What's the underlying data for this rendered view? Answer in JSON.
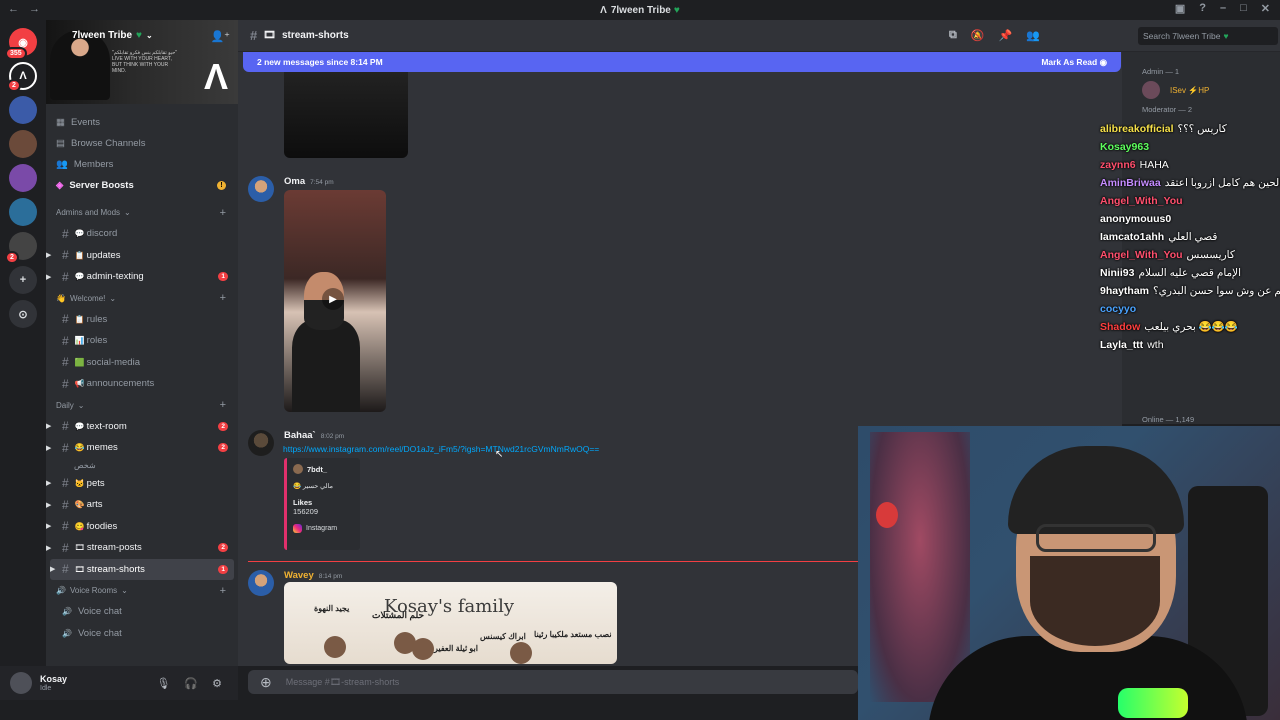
{
  "window": {
    "title": "7lween Tribe"
  },
  "rail": {
    "servers": [
      {
        "name": "discord-home",
        "badge": "355"
      },
      {
        "name": "7lween",
        "badge": "2"
      },
      {
        "name": "server-3",
        "badge": ""
      },
      {
        "name": "server-4",
        "badge": ""
      },
      {
        "name": "server-5",
        "badge": ""
      },
      {
        "name": "server-6",
        "badge": ""
      },
      {
        "name": "server-7",
        "badge": "2"
      }
    ]
  },
  "server": {
    "name": "7lween Tribe",
    "quote": "\"حيو تقابلكم بنس فكرو تقابلكم\" LIVE WITH YOUR HEART, BUT THINK WITH YOUR MIND."
  },
  "nav": {
    "events": "Events",
    "browse": "Browse Channels",
    "members": "Members",
    "boosts": "Server Boosts"
  },
  "categories": {
    "admins": "Admins and Mods",
    "welcome": "Welcome!",
    "daily": "Daily",
    "voice": "Voice Rooms"
  },
  "channels": {
    "admins": [
      {
        "name": "discord",
        "emoji": "💬",
        "count": "",
        "unread": false,
        "arrow": false
      },
      {
        "name": "updates",
        "emoji": "📋",
        "count": "",
        "unread": true,
        "arrow": true
      },
      {
        "name": "admin-texting",
        "emoji": "💬",
        "count": "1",
        "unread": true,
        "arrow": true
      }
    ],
    "welcome": [
      {
        "name": "rules",
        "emoji": "📋",
        "count": "",
        "unread": false,
        "arrow": false
      },
      {
        "name": "roles",
        "emoji": "📊",
        "count": "",
        "unread": false,
        "arrow": false
      },
      {
        "name": "social-media",
        "emoji": "🟩",
        "count": "",
        "unread": false,
        "arrow": false
      },
      {
        "name": "announcements",
        "emoji": "📢",
        "count": "",
        "unread": false,
        "arrow": false
      }
    ],
    "daily": [
      {
        "name": "text-room",
        "emoji": "💬",
        "count": "2",
        "unread": true,
        "arrow": true
      },
      {
        "name": "memes",
        "emoji": "😂",
        "count": "2",
        "unread": true,
        "arrow": true
      },
      {
        "name": "pets",
        "emoji": "🐱",
        "count": "",
        "unread": true,
        "arrow": true
      },
      {
        "name": "arts",
        "emoji": "🎨",
        "count": "",
        "unread": true,
        "arrow": true
      },
      {
        "name": "foodies",
        "emoji": "😋",
        "count": "",
        "unread": true,
        "arrow": true
      },
      {
        "name": "stream-posts",
        "emoji": "🎞",
        "count": "2",
        "unread": true,
        "arrow": true
      },
      {
        "name": "stream-shorts",
        "emoji": "🎞",
        "count": "1",
        "unread": true,
        "arrow": true,
        "active": true
      }
    ],
    "daily_sub": "شخص",
    "voice": [
      {
        "name": "Voice chat"
      },
      {
        "name": "Voice chat"
      }
    ]
  },
  "user": {
    "name": "Kosay",
    "status": "Idle"
  },
  "header": {
    "channel": "stream-shorts",
    "search": "Search 7lween Tribe"
  },
  "newbar": {
    "text": "2 new messages since 8:14 PM",
    "mark": "Mark As Read"
  },
  "messages": [
    {
      "author": "Oma",
      "time": "7:54 pm",
      "color": "#f2f3f5"
    },
    {
      "author": "Bahaa`",
      "time": "8:02 pm",
      "color": "#f2f3f5",
      "link": "https://www.instagram.com/reel/DO1aJz_iFm5/?igsh=MTNwd21rcGVmNmRwOQ==",
      "embed": {
        "author": "7bdt_",
        "desc": "مالي حسير",
        "likes_label": "Likes",
        "likes": "156209",
        "source": "Instagram"
      }
    },
    {
      "author": "Wavey",
      "time": "8:14 pm",
      "color": "#f2f3f5"
    }
  ],
  "family_image": {
    "title": "Kosay's family",
    "labels": [
      "يجيد النهوة",
      "حلم المشتلات",
      "نصب مستعد ملكيبا رئينا",
      "ابراك كيسنس",
      "ابو ثيلة العفير"
    ]
  },
  "composer": {
    "placeholder": "Message #🎞-stream-shorts"
  },
  "member_list": {
    "admin": "Admin — 1",
    "admin_member": "ISev ⚡HP",
    "moderator": "Moderator — 2",
    "online": "Online — 1,149"
  },
  "chat_overlay": [
    {
      "user": "alibreakofficial",
      "text": "كاريس ؟؟؟",
      "color": "#f5e04a"
    },
    {
      "user": "Kosay963",
      "text": "",
      "color": "#5dff5d"
    },
    {
      "user": "zaynn6",
      "text": "HAHA",
      "color": "#ff4f6d"
    },
    {
      "user": "AminBriwaa",
      "text": "روم الحين هم كامل ازروبا اعتقد",
      "color": "#c58cff"
    },
    {
      "user": "Angel_With_You",
      "text": "",
      "color": "#ff4f6d"
    },
    {
      "user": "anonymouus0",
      "text": "",
      "color": "#ffffff"
    },
    {
      "user": "Iamcato1ahh",
      "text": "قصي العلي",
      "color": "#ffffff"
    },
    {
      "user": "Angel_With_You",
      "text": "كاريسسس",
      "color": "#ff4f6d"
    },
    {
      "user": "Ninii93",
      "text": "الإمام قصي عليه السلام",
      "color": "#ffffff"
    },
    {
      "user": "9haytham",
      "text": "يعيال قصي تكلم عن وش سوا حسن البدري؟",
      "color": "#ffffff"
    },
    {
      "user": "cocyyo",
      "text": "",
      "color": "#4aa3ff"
    },
    {
      "user": "Shadow",
      "text": "بحري بيلعب 😂😂😂",
      "color": "#ff3f3f"
    },
    {
      "user": "Layla_ttt",
      "text": "wth",
      "color": "#ffffff"
    }
  ],
  "colors": {
    "accent": "#5865f2",
    "unread_badge": "#f23f43",
    "link": "#00a8fc"
  }
}
